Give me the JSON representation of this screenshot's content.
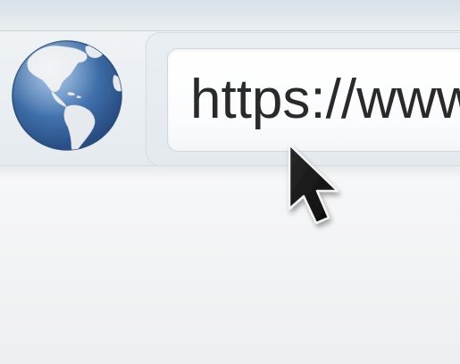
{
  "address_bar": {
    "url_text": "https://www."
  },
  "icons": {
    "globe": "globe-icon",
    "cursor": "mouse-pointer-icon"
  },
  "colors": {
    "globe_ocean": "#3e6ea8",
    "globe_land": "#e8ecef",
    "cursor": "#141414",
    "url_text": "#2a2a2a"
  }
}
